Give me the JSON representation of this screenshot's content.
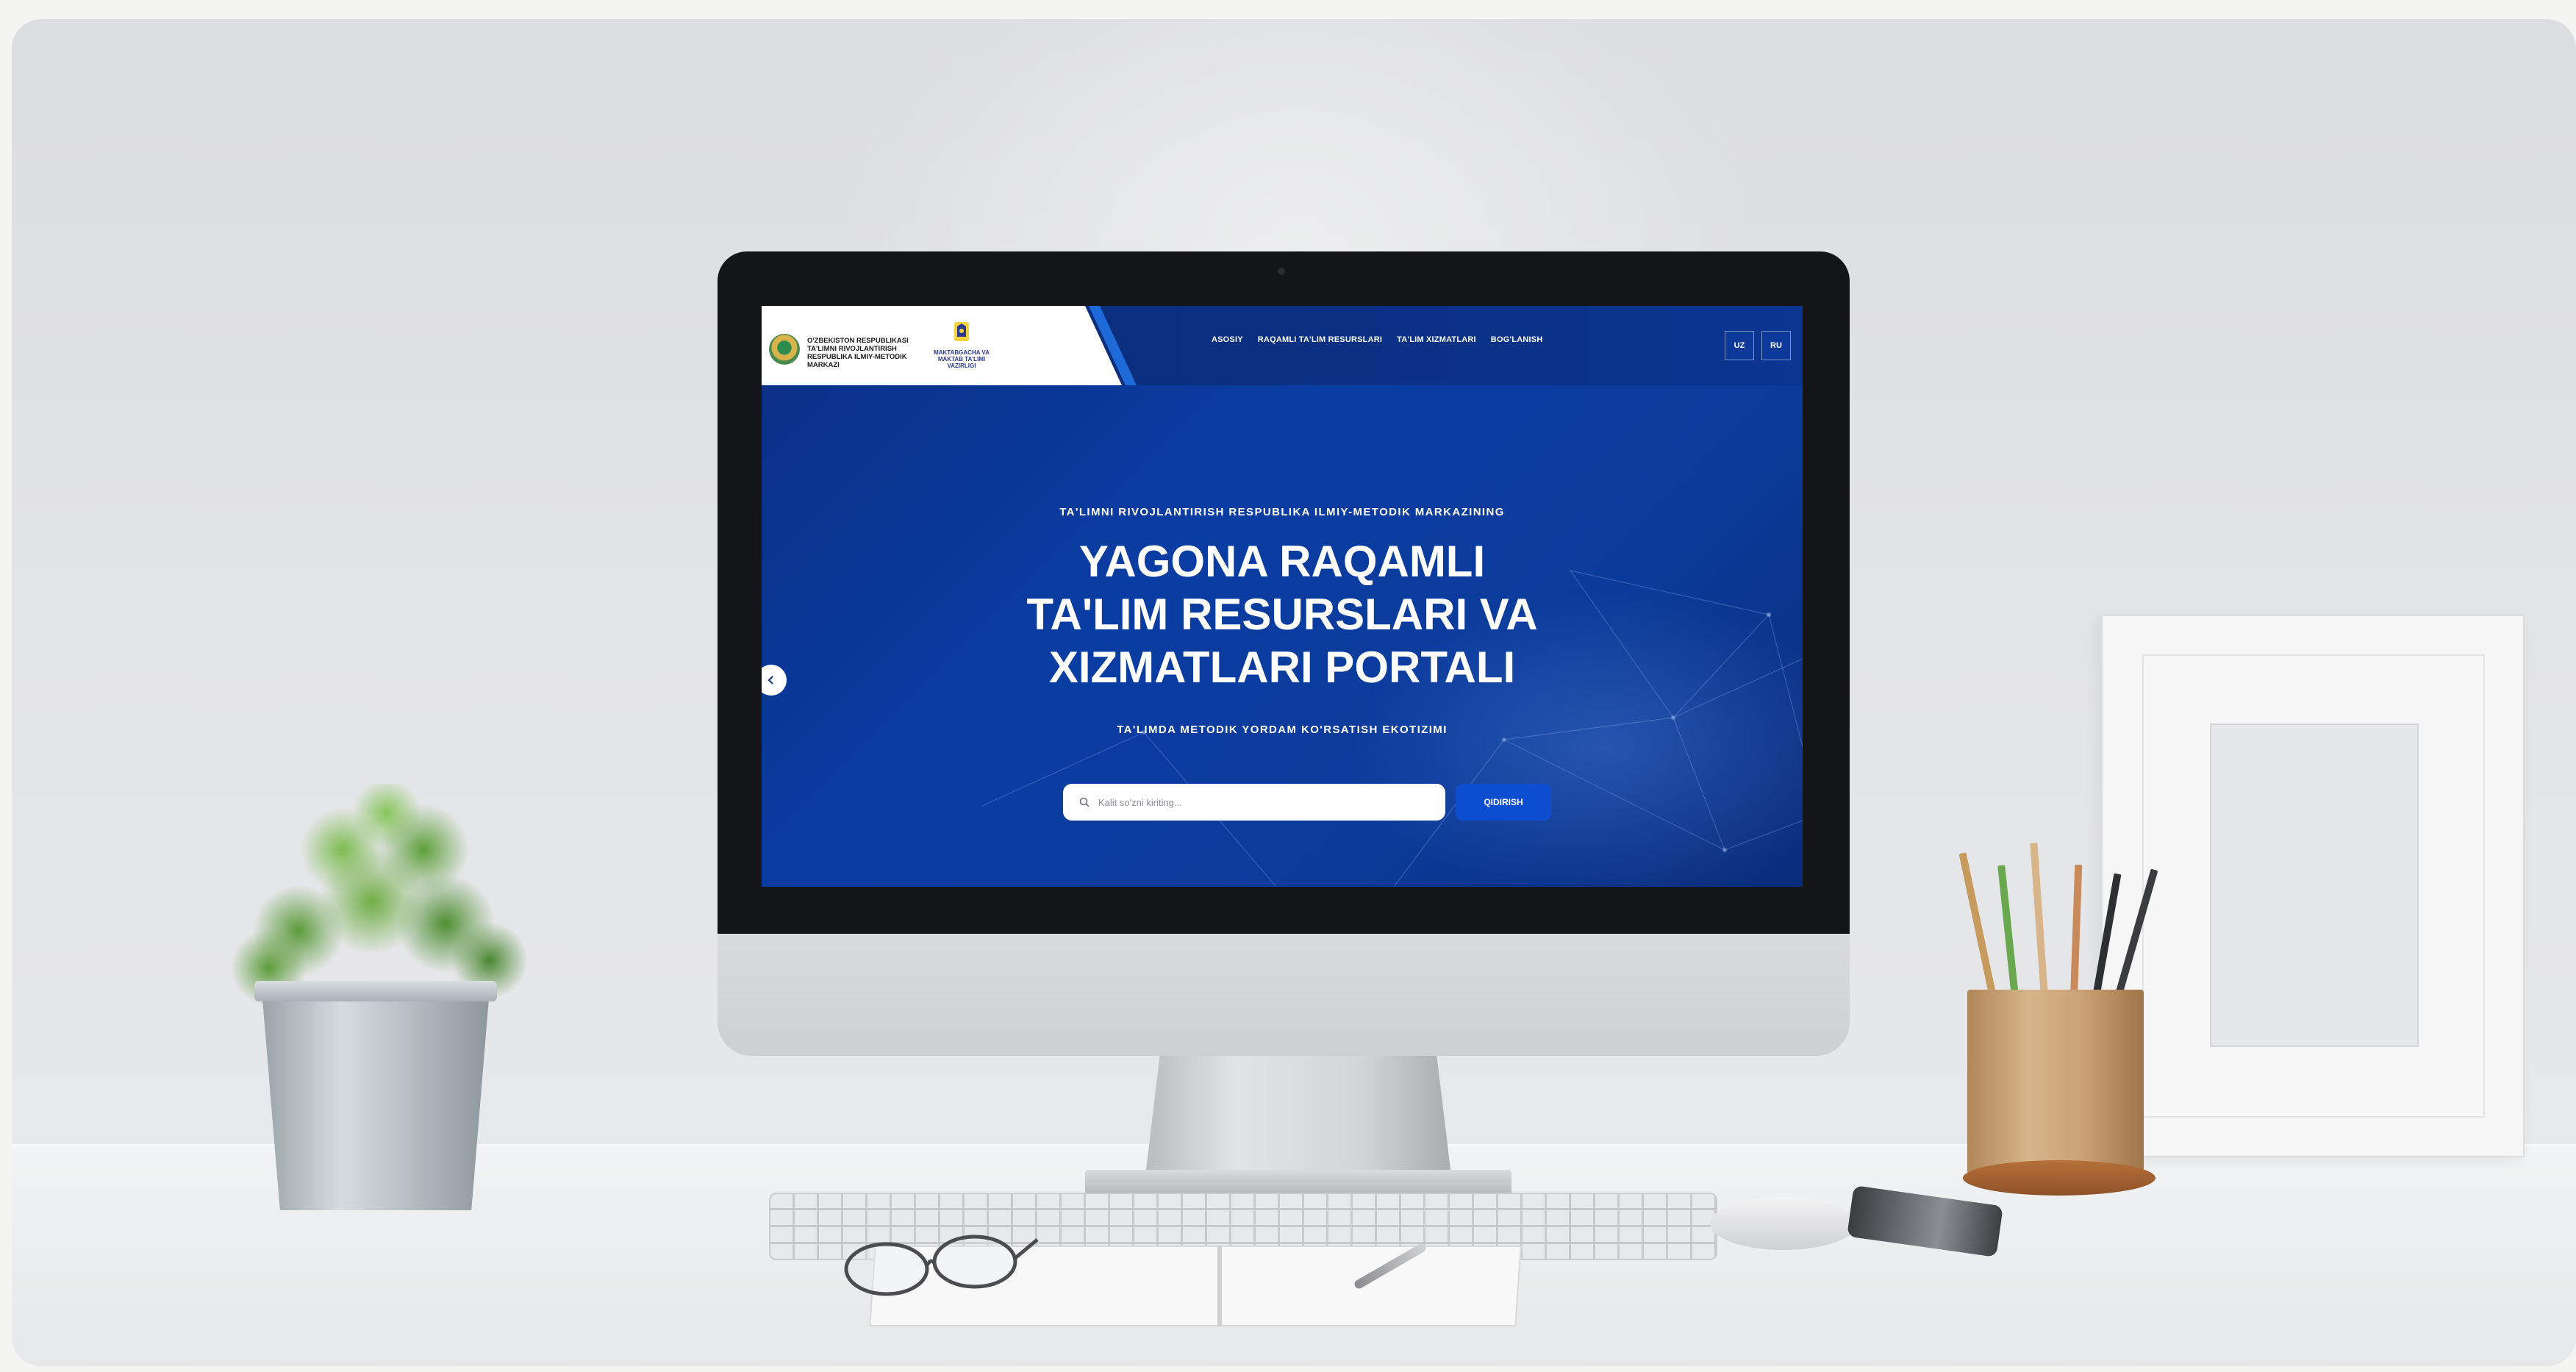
{
  "site": {
    "org_name": "O'zbekiston Respublikasi Ta'limni rivojlantirish Respublika ilmiy-metodik markazi",
    "ministry_name": "Maktabgacha va maktab ta'limi vazirligi"
  },
  "nav": {
    "items": [
      {
        "label": "ASOSIY"
      },
      {
        "label": "RAQAMLI TA'LIM RESURSLARI"
      },
      {
        "label": "TA'LIM XIZMATLARI"
      },
      {
        "label": "BOG'LANISH"
      }
    ]
  },
  "languages": [
    "UZ",
    "RU"
  ],
  "hero": {
    "eyebrow": "TA'LIMNI RIVOJLANTIRISH RESPUBLIKA ILMIY-METODIK MARKAZINING",
    "title": "YAGONA RAQAMLI TA'LIM RESURSLARI VA XIZMATLARI PORTALI",
    "subtitle": "TA'LIMDA METODIK YORDAM KO'RSATISH EKOTIZIMI"
  },
  "search": {
    "placeholder": "Kalit so'zni kiriting...",
    "button_label": "QIDIRISH"
  },
  "icons": {
    "search": "search-icon",
    "slider_prev": "arrow-left-icon",
    "emblem": "state-emblem-icon",
    "ministry": "ministry-logo-icon"
  },
  "colors": {
    "hero_blue": "#0a3da3",
    "header_dark": "#0b2a74",
    "button_blue": "#0d4ed0",
    "accent_edge": "#1e6ad8"
  }
}
